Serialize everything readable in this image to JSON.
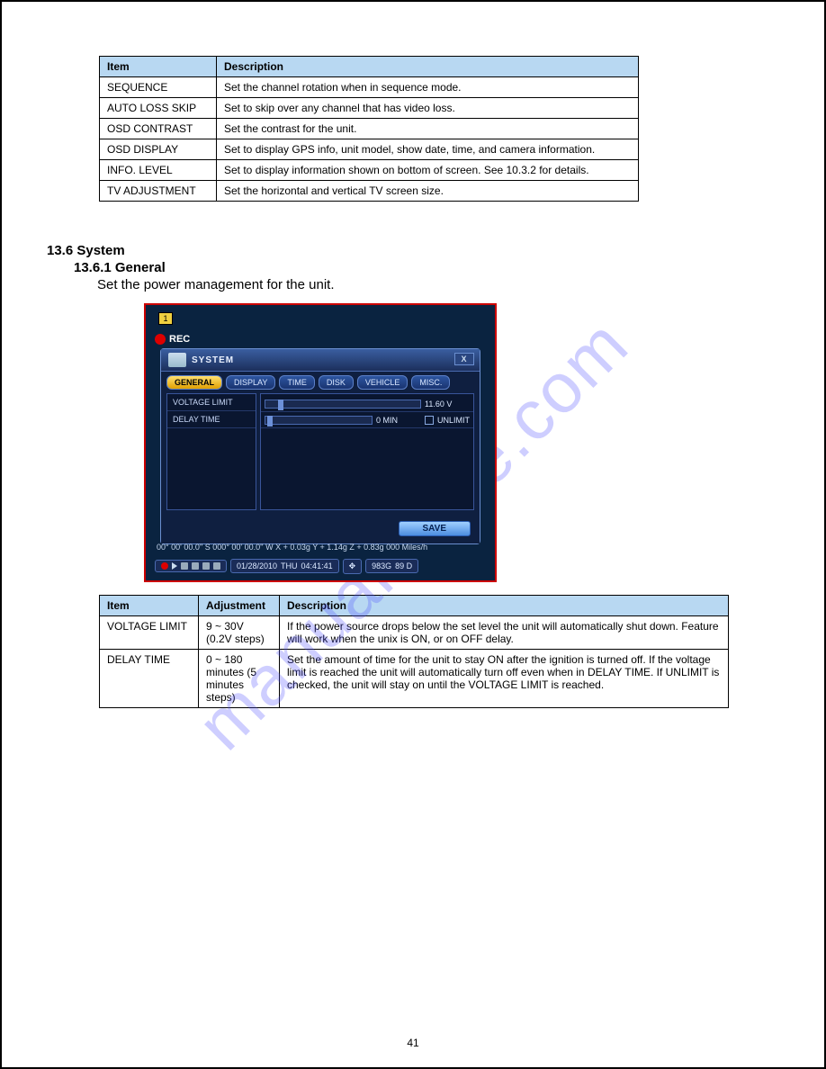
{
  "watermark": "manualshive.com",
  "table1": {
    "headers": {
      "item": "Item",
      "desc": "Description"
    },
    "rows": [
      {
        "item": "SEQUENCE",
        "desc": "Set the channel rotation when in sequence mode."
      },
      {
        "item": "AUTO LOSS SKIP",
        "desc": "Set to skip over any channel that has video loss."
      },
      {
        "item": "OSD CONTRAST",
        "desc": "Set the contrast for the unit."
      },
      {
        "item": "OSD DISPLAY",
        "desc": "Set to display GPS info, unit model, show date, time, and camera information."
      },
      {
        "item": "INFO. LEVEL",
        "desc": "Set to display information shown on bottom of screen. See 10.3.2 for details."
      },
      {
        "item": "TV ADJUSTMENT",
        "desc": "Set the horizontal and vertical TV screen size."
      }
    ]
  },
  "heading": {
    "title": "13.6 System",
    "sub1": "13.6.1 General",
    "desc1": "Set the power management for the unit."
  },
  "screenshot": {
    "cam_badge": "1",
    "rec_label": "REC",
    "window_title": "SYSTEM",
    "close_label": "X",
    "tabs": [
      "GENERAL",
      "DISPLAY",
      "TIME",
      "DISK",
      "VEHICLE",
      "MISC."
    ],
    "rows": [
      {
        "label": "VOLTAGE LIMIT",
        "value": "11.60 V",
        "thumb_pct": 8
      },
      {
        "label": "DELAY TIME",
        "value": "0 MIN",
        "thumb_pct": 2,
        "extra": "UNLIMIT"
      }
    ],
    "save": "SAVE",
    "gps_line": "00° 00' 00.0'' S   000° 00' 00.0'' W   X + 0.03g   Y + 1.14g   Z + 0.83g   000 Miles/h",
    "status": {
      "date": "01/28/2010",
      "day": "THU",
      "time": "04:41:41",
      "disk": "983G",
      "days": "89 D"
    }
  },
  "table2": {
    "headers": {
      "item": "Item",
      "adj": "Adjustment",
      "desc": "Description"
    },
    "rows": [
      {
        "item": "VOLTAGE LIMIT",
        "adj": "9 ~ 30V (0.2V steps)",
        "desc": "If the power source drops below the set level the unit will automatically shut down. Feature will work when the unix is ON, or on OFF delay."
      },
      {
        "item": "DELAY TIME",
        "adj": "0 ~ 180 minutes (5 minutes steps)",
        "desc": "Set the amount of time for the unit to stay ON after the ignition is turned off. If the voltage limit is reached the unit will automatically turn off even when in DELAY TIME. If UNLIMIT is checked, the unit will stay on until the VOLTAGE LIMIT is reached."
      }
    ]
  },
  "page_number": "41"
}
